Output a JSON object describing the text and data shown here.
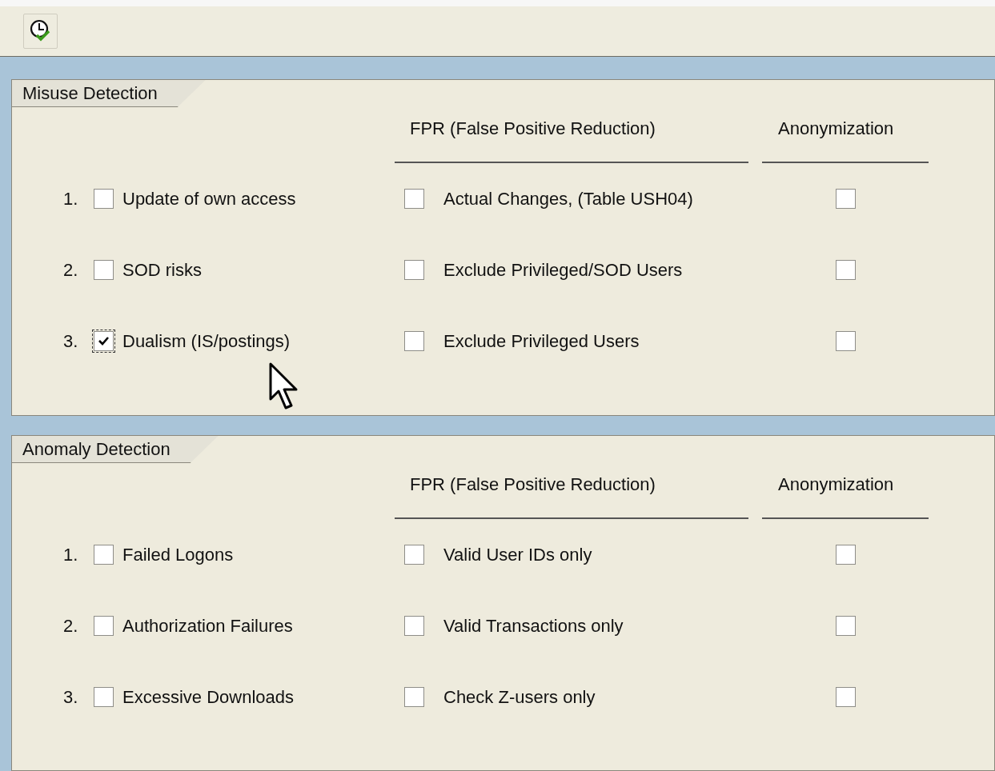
{
  "sections": [
    {
      "title": "Misuse Detection",
      "fpr_header": "FPR (False Positive Reduction)",
      "anon_header": "Anonymization",
      "rows": [
        {
          "number": "1.",
          "label": "Update of own access",
          "checked": false,
          "fpr_label": "Actual Changes, (Table USH04)",
          "fpr_checked": false,
          "anonymized": false
        },
        {
          "number": "2.",
          "label": "SOD risks",
          "checked": false,
          "fpr_label": "Exclude Privileged/SOD Users",
          "fpr_checked": false,
          "anonymized": false
        },
        {
          "number": "3.",
          "label": "Dualism (IS/postings)",
          "checked": true,
          "fpr_label": "Exclude Privileged Users",
          "fpr_checked": false,
          "anonymized": false
        }
      ]
    },
    {
      "title": "Anomaly Detection",
      "fpr_header": "FPR (False Positive Reduction)",
      "anon_header": "Anonymization",
      "rows": [
        {
          "number": "1.",
          "label": "Failed Logons",
          "checked": false,
          "fpr_label": "Valid User IDs only",
          "fpr_checked": false,
          "anonymized": false
        },
        {
          "number": "2.",
          "label": "Authorization Failures",
          "checked": false,
          "fpr_label": "Valid Transactions only",
          "fpr_checked": false,
          "anonymized": false
        },
        {
          "number": "3.",
          "label": "Excessive Downloads",
          "checked": false,
          "fpr_label": "Check Z-users only",
          "fpr_checked": false,
          "anonymized": false
        }
      ]
    }
  ]
}
